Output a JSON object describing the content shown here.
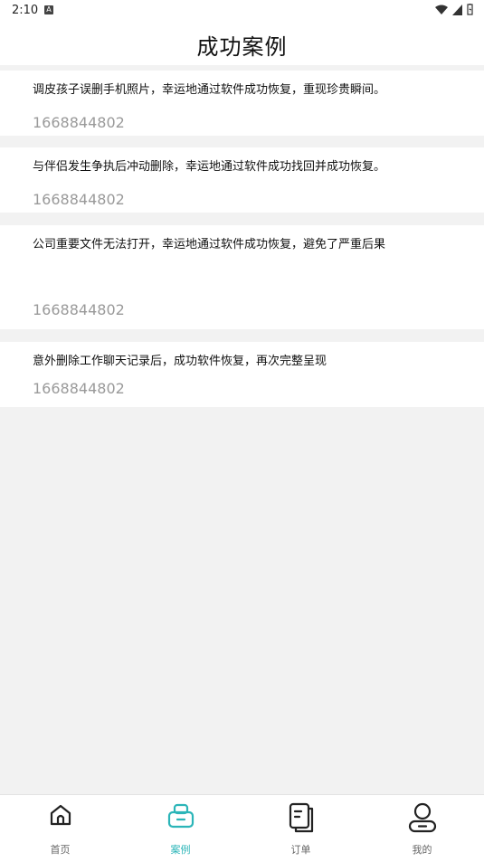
{
  "status_bar": {
    "time": "2:10",
    "notif_icon": "A"
  },
  "header": {
    "title": "成功案例"
  },
  "cases": [
    {
      "text": "调皮孩子误删手机照片，幸运地通过软件成功恢复，重现珍贵瞬间。",
      "phone": "1668844802"
    },
    {
      "text": "与伴侣发生争执后冲动删除，幸运地通过软件成功找回并成功恢复。",
      "phone": "1668844802"
    },
    {
      "text": "公司重要文件无法打开，幸运地通过软件成功恢复，避免了严重后果",
      "phone": "1668844802"
    },
    {
      "text": "意外删除工作聊天记录后，成功软件恢复，再次完整呈现",
      "phone": "1668844802"
    }
  ],
  "tabbar": {
    "tabs": [
      {
        "label": "首页",
        "icon": "home-icon",
        "active": false
      },
      {
        "label": "案例",
        "icon": "case-icon",
        "active": true
      },
      {
        "label": "订单",
        "icon": "order-icon",
        "active": false
      },
      {
        "label": "我的",
        "icon": "profile-icon",
        "active": false
      }
    ]
  },
  "colors": {
    "accent": "#2bb5b8",
    "background": "#f2f2f2",
    "phone_text": "#9a9a9a"
  }
}
